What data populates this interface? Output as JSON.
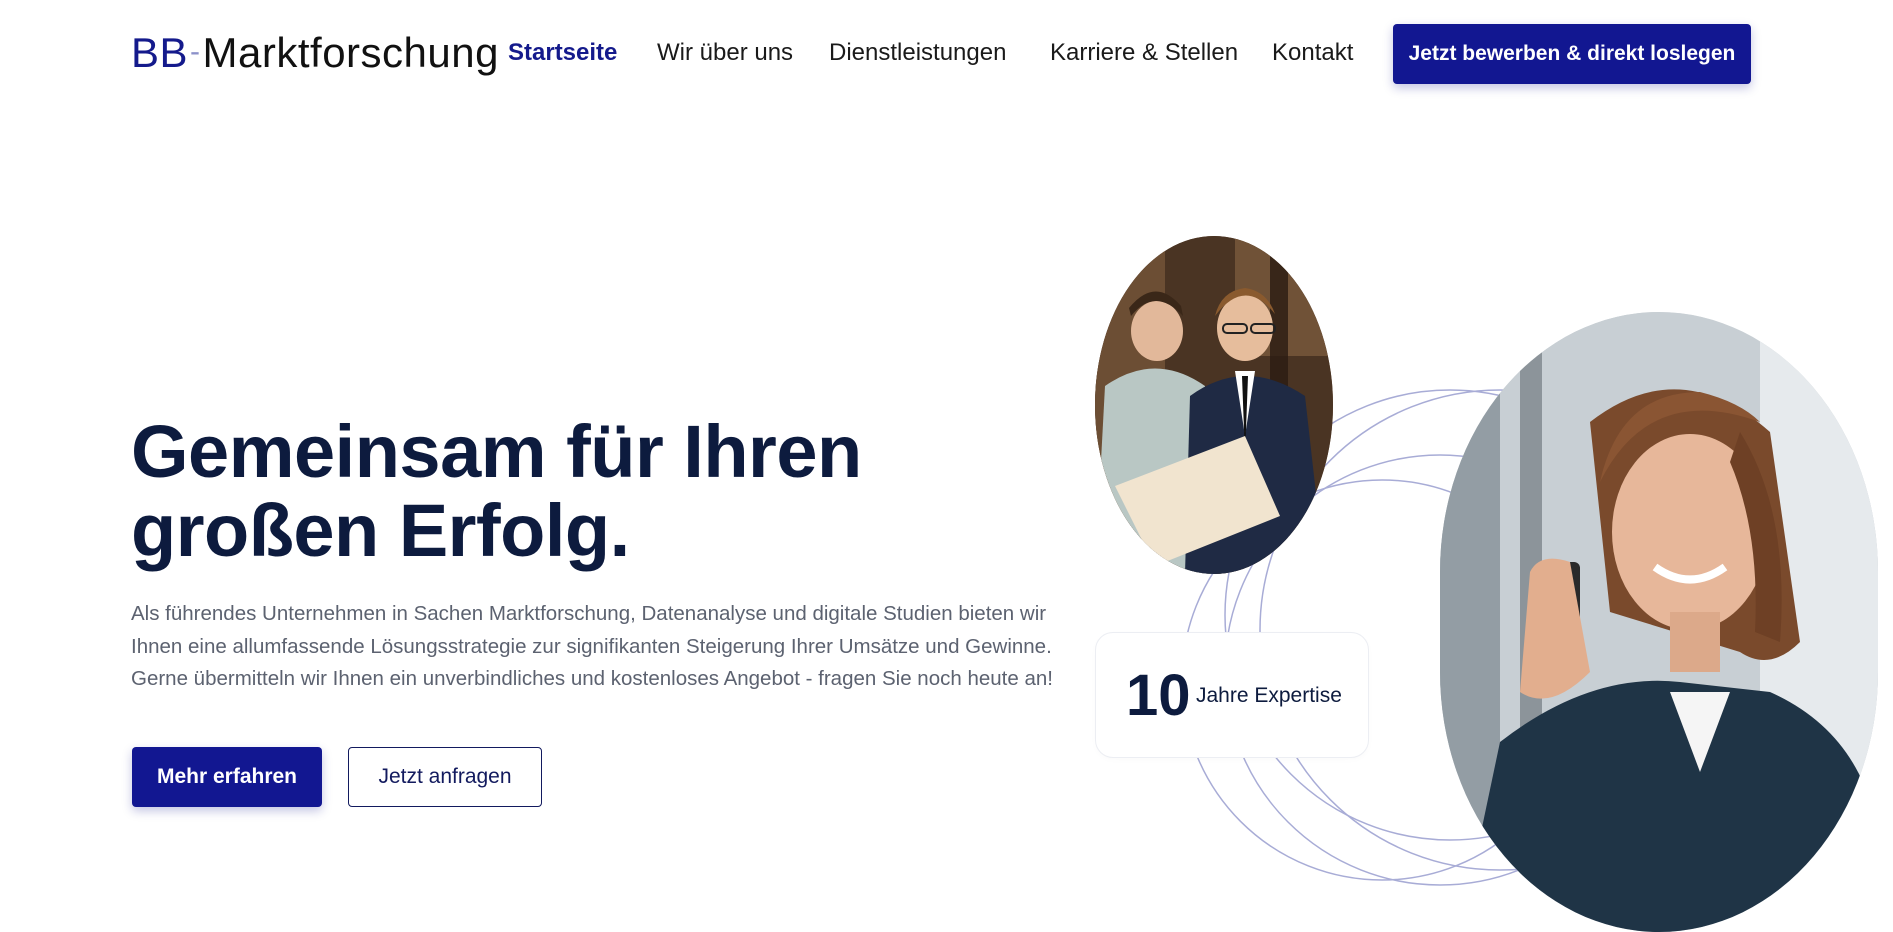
{
  "header": {
    "logo": {
      "part1": "BB",
      "separator": "-",
      "part2": "Marktforschung"
    },
    "nav": [
      {
        "label": "Startseite",
        "active": true
      },
      {
        "label": "Wir über uns",
        "active": false
      },
      {
        "label": "Dienstleistungen",
        "active": false
      },
      {
        "label": "Karriere & Stellen",
        "active": false
      },
      {
        "label": "Kontakt",
        "active": false
      }
    ],
    "cta_label": "Jetzt bewerben & direkt loslegen"
  },
  "hero": {
    "title_line1": "Gemeinsam für Ihren",
    "title_line2": "großen Erfolg.",
    "text_line1": "Als führendes Unternehmen in Sachen Marktforschung, Datenanalyse und digitale Studien bieten wir",
    "text_line2": "Ihnen eine allumfassende Lösungsstrategie zur signifikanten Steigerung Ihrer Umsätze und Gewinne.",
    "text_line3": "Gerne übermitteln wir Ihnen ein unverbindliches und kostenloses Angebot - fragen Sie noch heute an!",
    "primary_button": "Mehr erfahren",
    "secondary_button": "Jetzt anfragen"
  },
  "stat": {
    "number": "10",
    "label": "Jahre Expertise"
  },
  "colors": {
    "brand": "#121791",
    "heading": "#0d1b3e",
    "body_text": "#5c6270",
    "ring": "#a8acd6"
  }
}
